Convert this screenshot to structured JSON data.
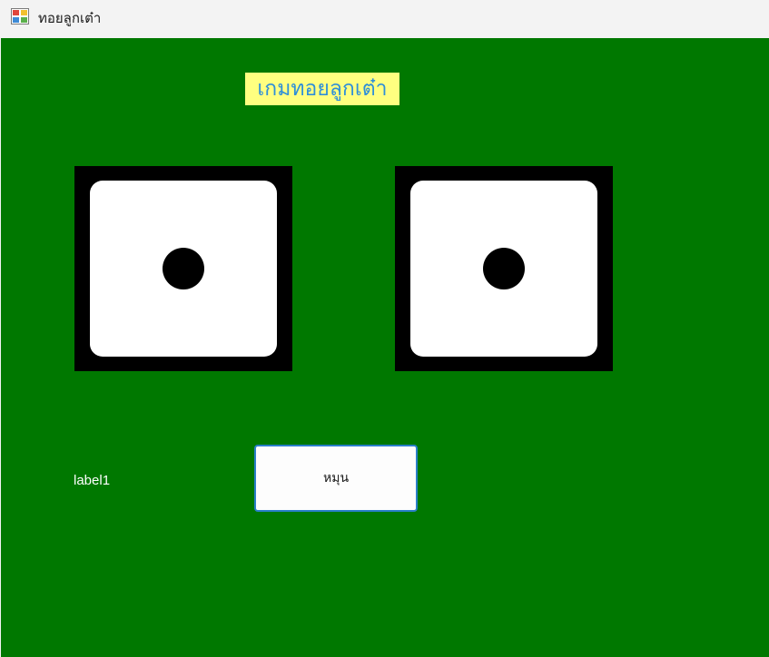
{
  "window": {
    "title": "ทอยลูกเต๋า",
    "icon": "windows-forms-app-icon"
  },
  "main": {
    "heading": "เกมทอยลูกเต๋า",
    "dice": [
      {
        "face_value": 1
      },
      {
        "face_value": 1
      }
    ],
    "result_label": "label1",
    "spin_button_label": "หมุน"
  },
  "colors": {
    "background": "#007800",
    "heading_background": "#ffff80",
    "heading_text": "#2f8fd8",
    "die_border": "#000000",
    "die_face": "#ffffff",
    "button_border": "#2a7fc9"
  }
}
